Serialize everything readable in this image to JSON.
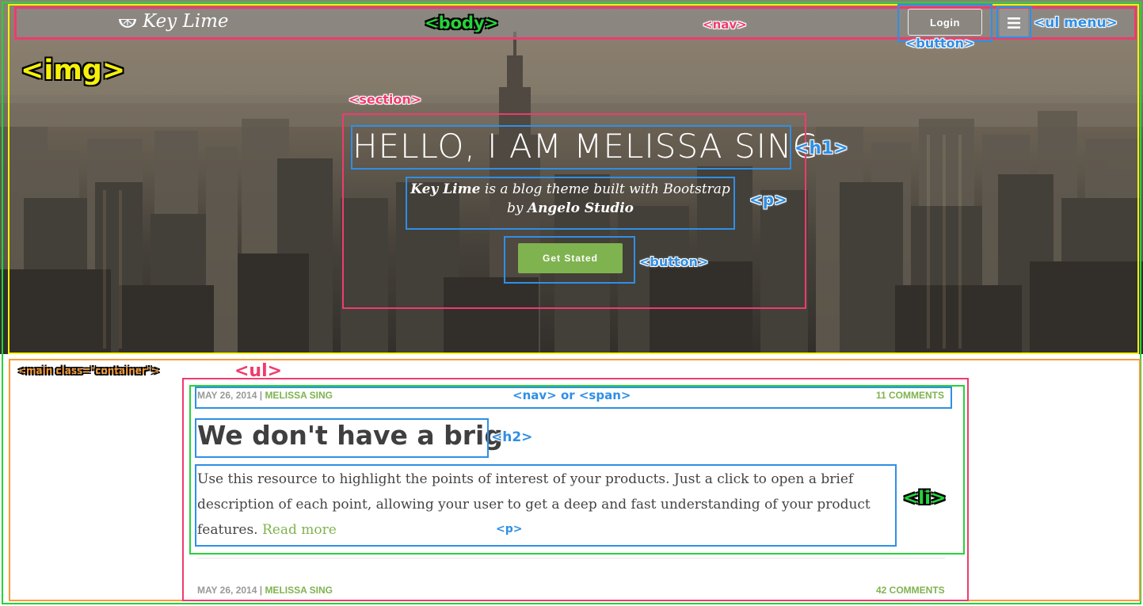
{
  "brand": {
    "name": "Key Lime",
    "icon": "lime-slice-icon"
  },
  "nav": {
    "login_label": "Login",
    "menu_icon": "hamburger-menu-icon"
  },
  "hero": {
    "title": "HELLO, I AM MELISSA SING",
    "subtitle_brand": "Key Lime",
    "subtitle_middle": " is a blog theme built with Bootstrap",
    "subtitle_by": "by ",
    "subtitle_studio": "Angelo Studio",
    "cta_label": "Get Stated"
  },
  "posts": [
    {
      "date": "MAY 26, 2014",
      "separator": " | ",
      "author": "MELISSA SING",
      "comments": "11 COMMENTS",
      "title": "We don't have a brig",
      "body": "Use this resource to highlight the points of interest of your products. Just a click to open a brief description of each point, allowing your user to get a deep and fast understanding of your product features. ",
      "read_more": "Read more"
    },
    {
      "date": "MAY 26, 2014",
      "separator": " | ",
      "author": "MELISSA SING",
      "comments": "42 COMMENTS"
    }
  ],
  "annotations": {
    "body": "<body>",
    "nav": "<nav>",
    "ul_menu": "<ul menu>",
    "button_login": "<button>",
    "img": "<img>",
    "section": "<section>",
    "h1": "<h1>",
    "p_hero": "<p>",
    "button_cta": "<button>",
    "main": "<main class=\"container\">",
    "ul": "<ul>",
    "nav_or_span": "<nav> or <span>",
    "h2": "<h2>",
    "li": "<li>",
    "p_post": "<p>"
  },
  "colors": {
    "accent_green": "#7fb34f",
    "annotation_pink": "#ef3b6e",
    "annotation_blue": "#2f8fe6",
    "annotation_green": "#25d33a",
    "annotation_yellow": "#f5f10a",
    "annotation_orange": "#f59b3a"
  }
}
